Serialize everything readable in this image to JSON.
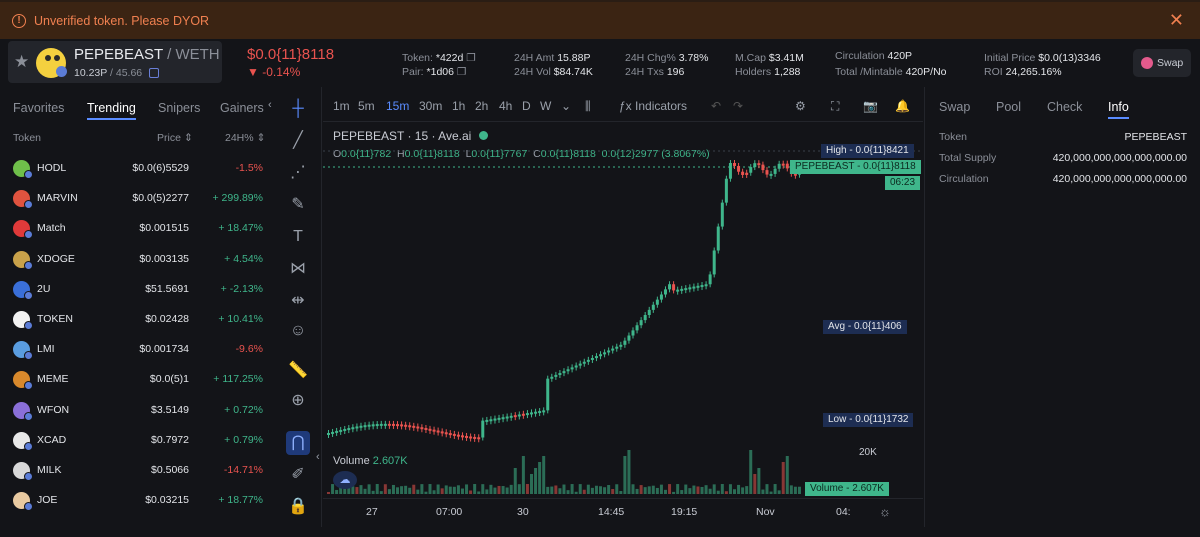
{
  "warning": {
    "text": "Unverified token. Please DYOR",
    "icon": "alert-circle-icon",
    "close": "✕"
  },
  "token": {
    "name": "PEPEBEAST",
    "pair": "/ WETH",
    "sub_left": "10.23P",
    "sub_right": "/ 45.66",
    "price": "$0.0{11}8118",
    "change": "-0.14%"
  },
  "stats": {
    "token_label": "Token:",
    "token_value": "*422d",
    "pair_label": "Pair:",
    "pair_value": "*1d06",
    "amt_label": "24H Amt",
    "amt_value": "15.88P",
    "vol_label": "24H Vol",
    "vol_value": "$84.74K",
    "chg_label": "24H Chg%",
    "chg_value": "3.78%",
    "txs_label": "24H Txs",
    "txs_value": "196",
    "mcap_label": "M.Cap",
    "mcap_value": "$3.41M",
    "holders_label": "Holders",
    "holders_value": "1,288",
    "circ_label": "Circulation",
    "circ_value": "420P",
    "total_label": "Total /Mintable",
    "total_value": "420P/No",
    "init_label": "Initial Price",
    "init_value": "$0.0(13)3346",
    "roi_label": "ROI",
    "roi_value": "24,265.16%",
    "swap_button": "Swap"
  },
  "left": {
    "tabs": [
      "Favorites",
      "Trending",
      "Snipers",
      "Gainers"
    ],
    "active_tab": 1,
    "col_token": "Token",
    "col_price": "Price",
    "col_change": "24H%",
    "rows": [
      {
        "name": "HODL",
        "price": "$0.0(6)5529",
        "change": "-1.5%",
        "dir": "dn",
        "color": "#6fbf4a"
      },
      {
        "name": "MARVIN",
        "price": "$0.0(5)2277",
        "change": "+ 299.89%",
        "dir": "up",
        "color": "#e0533f"
      },
      {
        "name": "Match",
        "price": "$0.001515",
        "change": "+ 18.47%",
        "dir": "up",
        "color": "#e03a3a"
      },
      {
        "name": "XDOGE",
        "price": "$0.003135",
        "change": "+ 4.54%",
        "dir": "up",
        "color": "#c9a24a"
      },
      {
        "name": "2U",
        "price": "$51.5691",
        "change": "+ -2.13%",
        "dir": "up",
        "color": "#3a6fd8"
      },
      {
        "name": "TOKEN",
        "price": "$0.02428",
        "change": "+ 10.41%",
        "dir": "up",
        "color": "#f2f2f2"
      },
      {
        "name": "LMI",
        "price": "$0.001734",
        "change": "-9.6%",
        "dir": "dn",
        "color": "#5a9de0"
      },
      {
        "name": "MEME",
        "price": "$0.0(5)1",
        "change": "+ 117.25%",
        "dir": "up",
        "color": "#d8892c"
      },
      {
        "name": "WFON",
        "price": "$3.5149",
        "change": "+ 0.72%",
        "dir": "up",
        "color": "#8a6fd8"
      },
      {
        "name": "XCAD",
        "price": "$0.7972",
        "change": "+ 0.79%",
        "dir": "up",
        "color": "#e8e8e8"
      },
      {
        "name": "MILK",
        "price": "$0.5066",
        "change": "-14.71%",
        "dir": "dn",
        "color": "#d8d8d8"
      },
      {
        "name": "JOE",
        "price": "$0.03215",
        "change": "+ 18.77%",
        "dir": "up",
        "color": "#e8c9a0"
      }
    ]
  },
  "chart": {
    "timeframes": [
      "1m",
      "5m",
      "15m",
      "30m",
      "1h",
      "2h",
      "4h",
      "D",
      "W"
    ],
    "active_tf": 2,
    "indicators": "Indicators",
    "legend_title": "PEPEBEAST · 15 · Ave.ai",
    "o_label": "O",
    "o_value": "0.0{11}782",
    "h_label": "H",
    "h_value": "0.0{11}8118",
    "l_label": "L",
    "l_value": "0.0{11}7767",
    "c_label": "C",
    "c_value": "0.0{11}8118",
    "diff": "0.0{12}2977 (3.8067%)",
    "high_label": "High - 0.0{11}8421",
    "last_label": "PEPEBEAST - 0.0{11}8118",
    "countdown": "06:23",
    "avg_label": "Avg - 0.0{11}406",
    "low_label": "Low - 0.0{11}1732",
    "volume_label": "Volume",
    "volume_value": "2.607K",
    "volume_axis": "20K",
    "volume_tag": "Volume - 2.607K",
    "x_ticks": [
      "27",
      "07:00",
      "30",
      "14:45",
      "19:15",
      "Nov",
      "04:"
    ]
  },
  "right": {
    "tabs": [
      "Swap",
      "Pool",
      "Check",
      "Info"
    ],
    "active_tab": 3,
    "info": [
      {
        "k": "Token",
        "v": "PEPEBEAST"
      },
      {
        "k": "Total Supply",
        "v": "420,000,000,000,000,000.00"
      },
      {
        "k": "Circulation",
        "v": "420,000,000,000,000,000.00"
      }
    ]
  },
  "colors": {
    "up": "#3fb68b",
    "down": "#e9534f",
    "accent": "#5a8cff",
    "warn": "#f08050"
  }
}
